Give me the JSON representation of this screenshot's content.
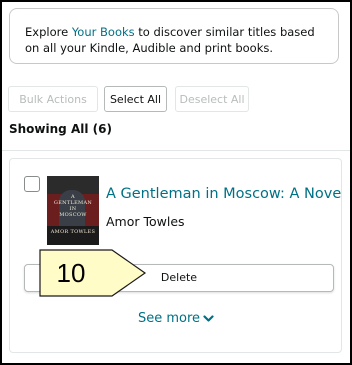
{
  "info": {
    "text_before": "Explore ",
    "link_text": "Your Books",
    "text_after": " to discover similar titles based on all your Kindle, Audible and print books."
  },
  "actions": {
    "bulk_label": "Bulk Actions",
    "select_all_label": "Select All",
    "deselect_all_label": "Deselect All"
  },
  "showing_label": "Showing All (6)",
  "book": {
    "title": "A Gentleman in Moscow: A Novel",
    "author": "Amor Towles",
    "cover_text_top": "A",
    "cover_text_mid1": "GENTLEMAN",
    "cover_text_mid2": "IN",
    "cover_text_mid3": "MOSCOW",
    "cover_author": "AMOR TOWLES",
    "delete_label": "Delete"
  },
  "see_more_label": "See more",
  "callout": {
    "number": "10"
  },
  "colors": {
    "link": "#007185",
    "callout_fill": "#fffcc8",
    "border": "#d5d9d9"
  }
}
